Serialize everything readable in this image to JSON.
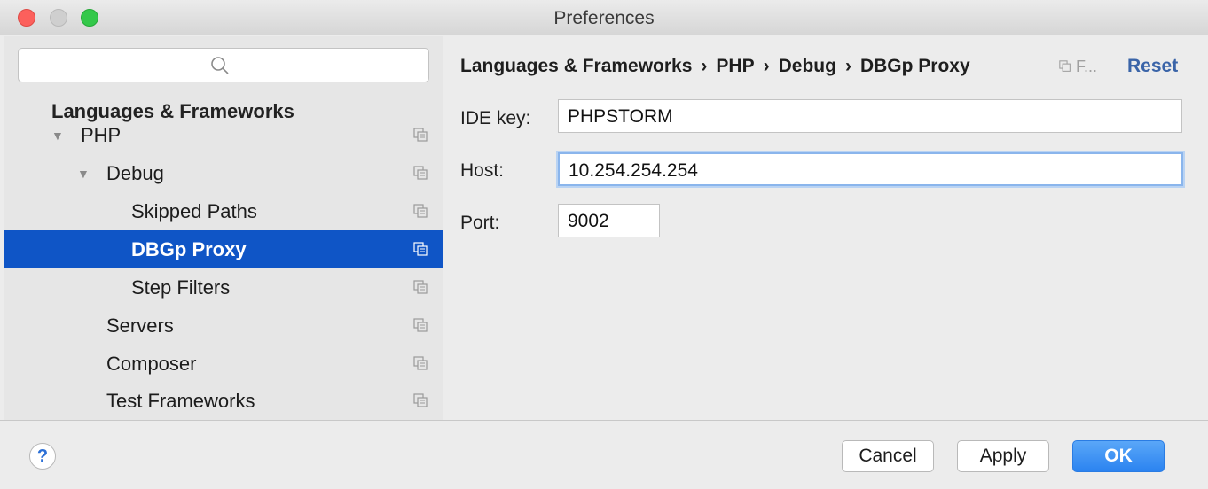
{
  "window": {
    "title": "Preferences"
  },
  "sidebar": {
    "search_placeholder": "",
    "group_header": "Languages & Frameworks",
    "items": [
      {
        "label": "PHP",
        "expanded": true
      },
      {
        "label": "Debug",
        "expanded": true
      },
      {
        "label": "Skipped Paths"
      },
      {
        "label": "DBGp Proxy",
        "selected": true
      },
      {
        "label": "Step Filters"
      },
      {
        "label": "Servers"
      },
      {
        "label": "Composer"
      },
      {
        "label": "Test Frameworks"
      }
    ]
  },
  "main": {
    "breadcrumb": [
      "Languages & Frameworks",
      "PHP",
      "Debug",
      "DBGp Proxy"
    ],
    "breadcrumb_separator": "›",
    "breadcrumb_extra": "F...",
    "reset_label": "Reset",
    "fields": [
      {
        "label": "IDE key:",
        "value": "PHPSTORM"
      },
      {
        "label": "Host:",
        "value": "10.254.254.254",
        "focused": true
      },
      {
        "label": "Port:",
        "value": "9002"
      }
    ]
  },
  "footer": {
    "help_label": "?",
    "cancel_label": "Cancel",
    "apply_label": "Apply",
    "ok_label": "OK"
  },
  "colors": {
    "selection": "#0f55c6",
    "primary_button": "#2b83f0",
    "link": "#3a64a8",
    "focus_ring": "#8ab5ec"
  },
  "icons": {
    "search": "magnifier-icon",
    "project_scope": "copy-scope-icon",
    "tree_expanded": "triangle-down-icon"
  }
}
